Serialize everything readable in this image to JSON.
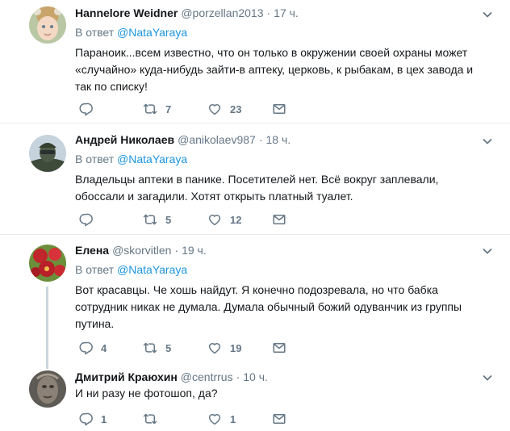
{
  "tweets": [
    {
      "name": "Hannelore Weidner",
      "handle": "@porzellan2013",
      "separator": "·",
      "time": "17 ч.",
      "reply_prefix": "В ответ",
      "reply_to": "@NataYaraya",
      "text": "Параноик...всем известно, что он только в окружении своей охраны может «случайно» куда-нибудь зайти-в аптеку, церковь, к рыбакам, в цех завода и так по списку!",
      "replies": "",
      "retweets": "7",
      "likes": "23",
      "avatar_icon": "child-photo-avatar"
    },
    {
      "name": "Андрей Николаев",
      "handle": "@anikolaev987",
      "separator": "·",
      "time": "18 ч.",
      "reply_prefix": "В ответ",
      "reply_to": "@NataYaraya",
      "text": "Владельцы аптеки в панике. Посетителей нет. Всё вокруг заплевали, обоссали и загадили. Хотят открыть платный туалет.",
      "replies": "",
      "retweets": "5",
      "likes": "12",
      "avatar_icon": "soldier-photo-avatar"
    },
    {
      "name": "Елена",
      "handle": "@skorvitlen",
      "separator": "·",
      "time": "19 ч.",
      "reply_prefix": "В ответ",
      "reply_to": "@NataYaraya",
      "text": "Вот красавцы. Че хошь найдут. Я конечно подозревала, но что бабка сотрудник никак не думала. Думала обычный божий одуванчик из группы путина.",
      "replies": "4",
      "retweets": "5",
      "likes": "19",
      "avatar_icon": "flowers-photo-avatar"
    },
    {
      "name": "Дмитрий Краюхин",
      "handle": "@centrrus",
      "separator": "·",
      "time": "10 ч.",
      "text": "И ни разу не фотошоп, да?",
      "replies": "1",
      "retweets": "",
      "likes": "1",
      "avatar_icon": "sculpture-photo-avatar"
    }
  ],
  "icons": {
    "reply": "reply-icon",
    "retweet": "retweet-icon",
    "like": "heart-icon",
    "message": "envelope-icon",
    "menu": "chevron-down-icon"
  },
  "colors": {
    "link": "#1b95e0",
    "secondary": "#657786",
    "divider": "#e6ecf0",
    "thread_line": "#ccd6dd"
  }
}
